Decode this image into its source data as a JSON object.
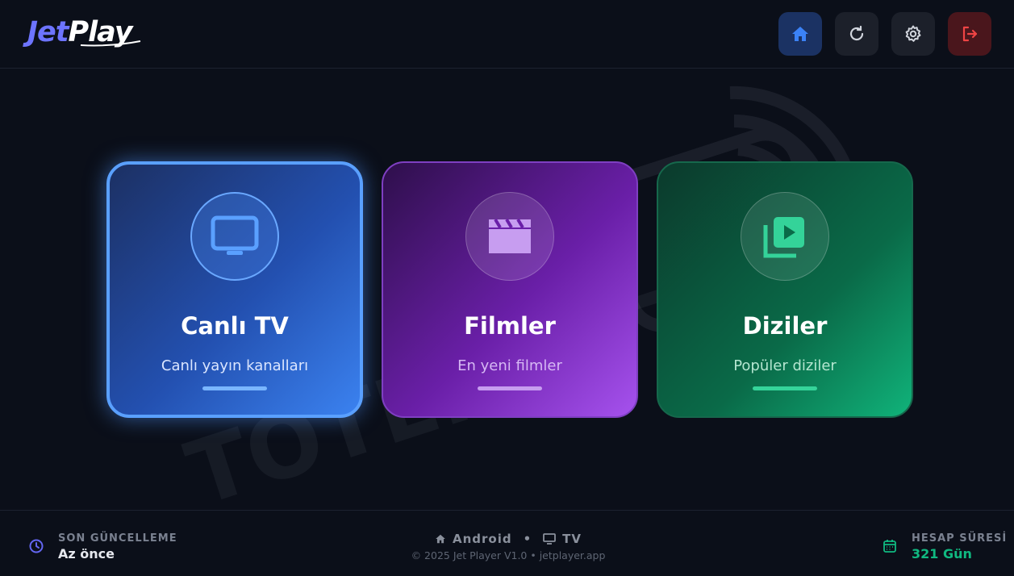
{
  "header": {
    "logo": {
      "part1": "Jet",
      "part2": "Play"
    },
    "buttons": [
      {
        "name": "home",
        "icon": "home-icon",
        "color": "#3b82f6"
      },
      {
        "name": "refresh",
        "icon": "refresh-icon",
        "color": "#d0d4dc"
      },
      {
        "name": "settings",
        "icon": "gear-icon",
        "color": "#d0d4dc"
      },
      {
        "name": "logout",
        "icon": "logout-icon",
        "color": "#ef4444"
      }
    ]
  },
  "cards": {
    "live": {
      "title": "Canlı TV",
      "subtitle": "Canlı yayın kanalları",
      "icon": "tv-icon",
      "accent": "#5aa0ff"
    },
    "movies": {
      "title": "Filmler",
      "subtitle": "En yeni filmler",
      "icon": "clapperboard-icon",
      "accent": "#c084fc"
    },
    "series": {
      "title": "Diziler",
      "subtitle": "Popüler diziler",
      "icon": "video-library-icon",
      "accent": "#34d399"
    }
  },
  "footer": {
    "last_update": {
      "label": "SON GÜNCELLEME",
      "value": "Az önce",
      "icon": "clock-icon",
      "color": "#6366f1"
    },
    "platform": {
      "home_label": "Android",
      "separator": "•",
      "tv_label": "TV"
    },
    "copyright": "© 2025 Jet Player V1.0 • jetplayer.app",
    "account": {
      "label": "HESAP SÜRESİ",
      "value": "321 Gün",
      "icon": "calendar-icon",
      "color": "#10b981"
    }
  }
}
